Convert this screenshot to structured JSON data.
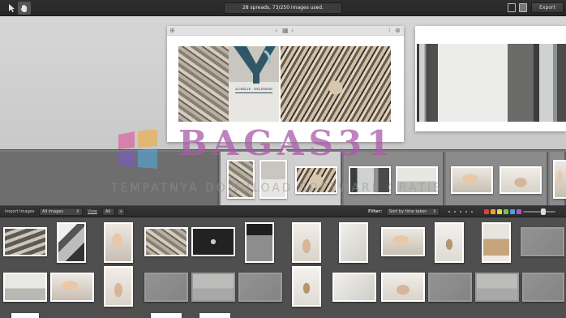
{
  "toolbar": {
    "pointer_tool": "pointer-tool",
    "hand_tool": "hand-tool",
    "status_text": "28 spreads, 73/250 images used.",
    "export_label": "Export"
  },
  "spread": {
    "couple_names": "AURÉLIE · DELPHINE"
  },
  "library_bar": {
    "import_label": "Import Images",
    "images_option": "All images",
    "view_label": "View",
    "view_value": "All",
    "filter_label": "Filter:",
    "sort_option": "Sort by time taken"
  },
  "colors": {
    "swatches": [
      "#d8443a",
      "#e9a531",
      "#e4d94a",
      "#7cc04b",
      "#4aa3d8",
      "#a85bc7"
    ]
  },
  "watermark": {
    "brand": "BAGAS31",
    "tagline": "TEMPATNYA DOWNLOAD SOFTWARE GRATIS"
  }
}
